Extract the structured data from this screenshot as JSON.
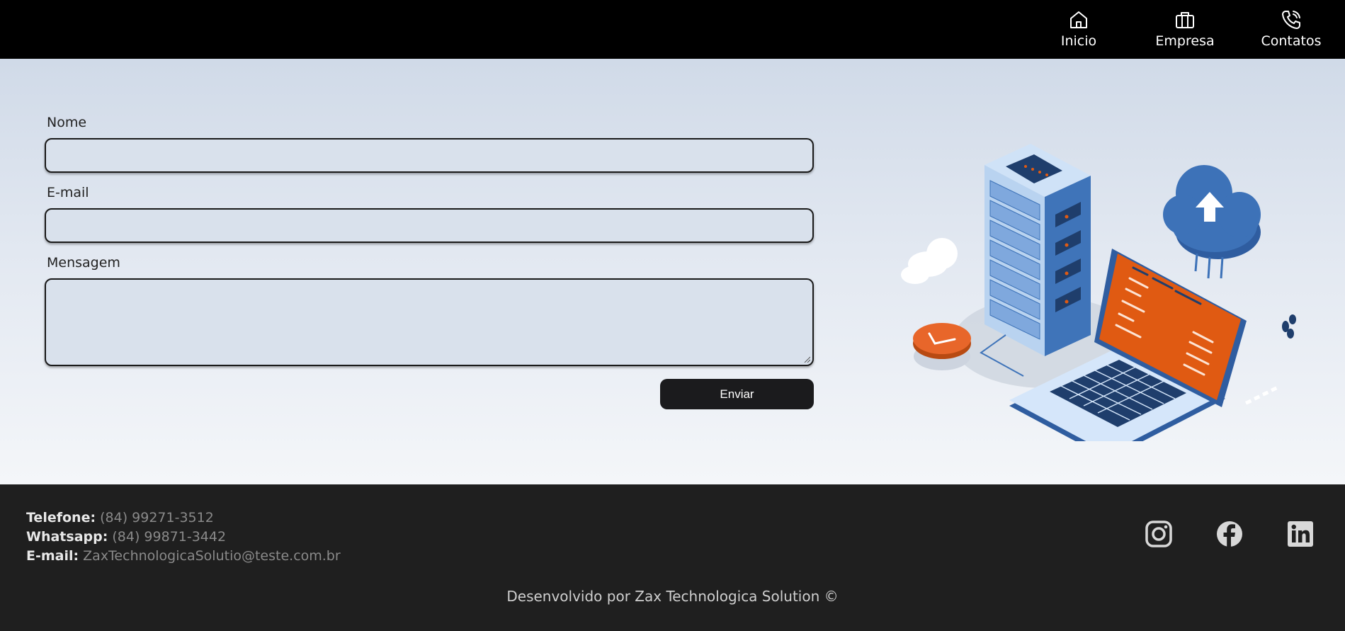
{
  "nav": {
    "items": [
      {
        "label": "Inicio",
        "icon": "home-icon"
      },
      {
        "label": "Empresa",
        "icon": "briefcase-icon"
      },
      {
        "label": "Contatos",
        "icon": "phone-icon"
      }
    ]
  },
  "form": {
    "name_label": "Nome",
    "name_value": "",
    "email_label": "E-mail",
    "email_value": "",
    "message_label": "Mensagem",
    "message_value": "",
    "submit_label": "Enviar"
  },
  "footer": {
    "phone_label": "Telefone:",
    "phone_value": "(84) 99271-3512",
    "whatsapp_label": "Whatsapp:",
    "whatsapp_value": "(84) 99871-3442",
    "email_label": "E-mail:",
    "email_value": "ZaxTechnologicaSolutio@teste.com.br",
    "social": [
      "instagram-icon",
      "facebook-icon",
      "linkedin-icon"
    ],
    "credit": "Desenvolvido por Zax Technologica Solution ©"
  },
  "colors": {
    "header_bg": "#000000",
    "footer_bg": "#1f1f1f",
    "button_bg": "#1b1b1d",
    "accent_orange": "#e05a12",
    "accent_blue": "#3d72b8"
  }
}
